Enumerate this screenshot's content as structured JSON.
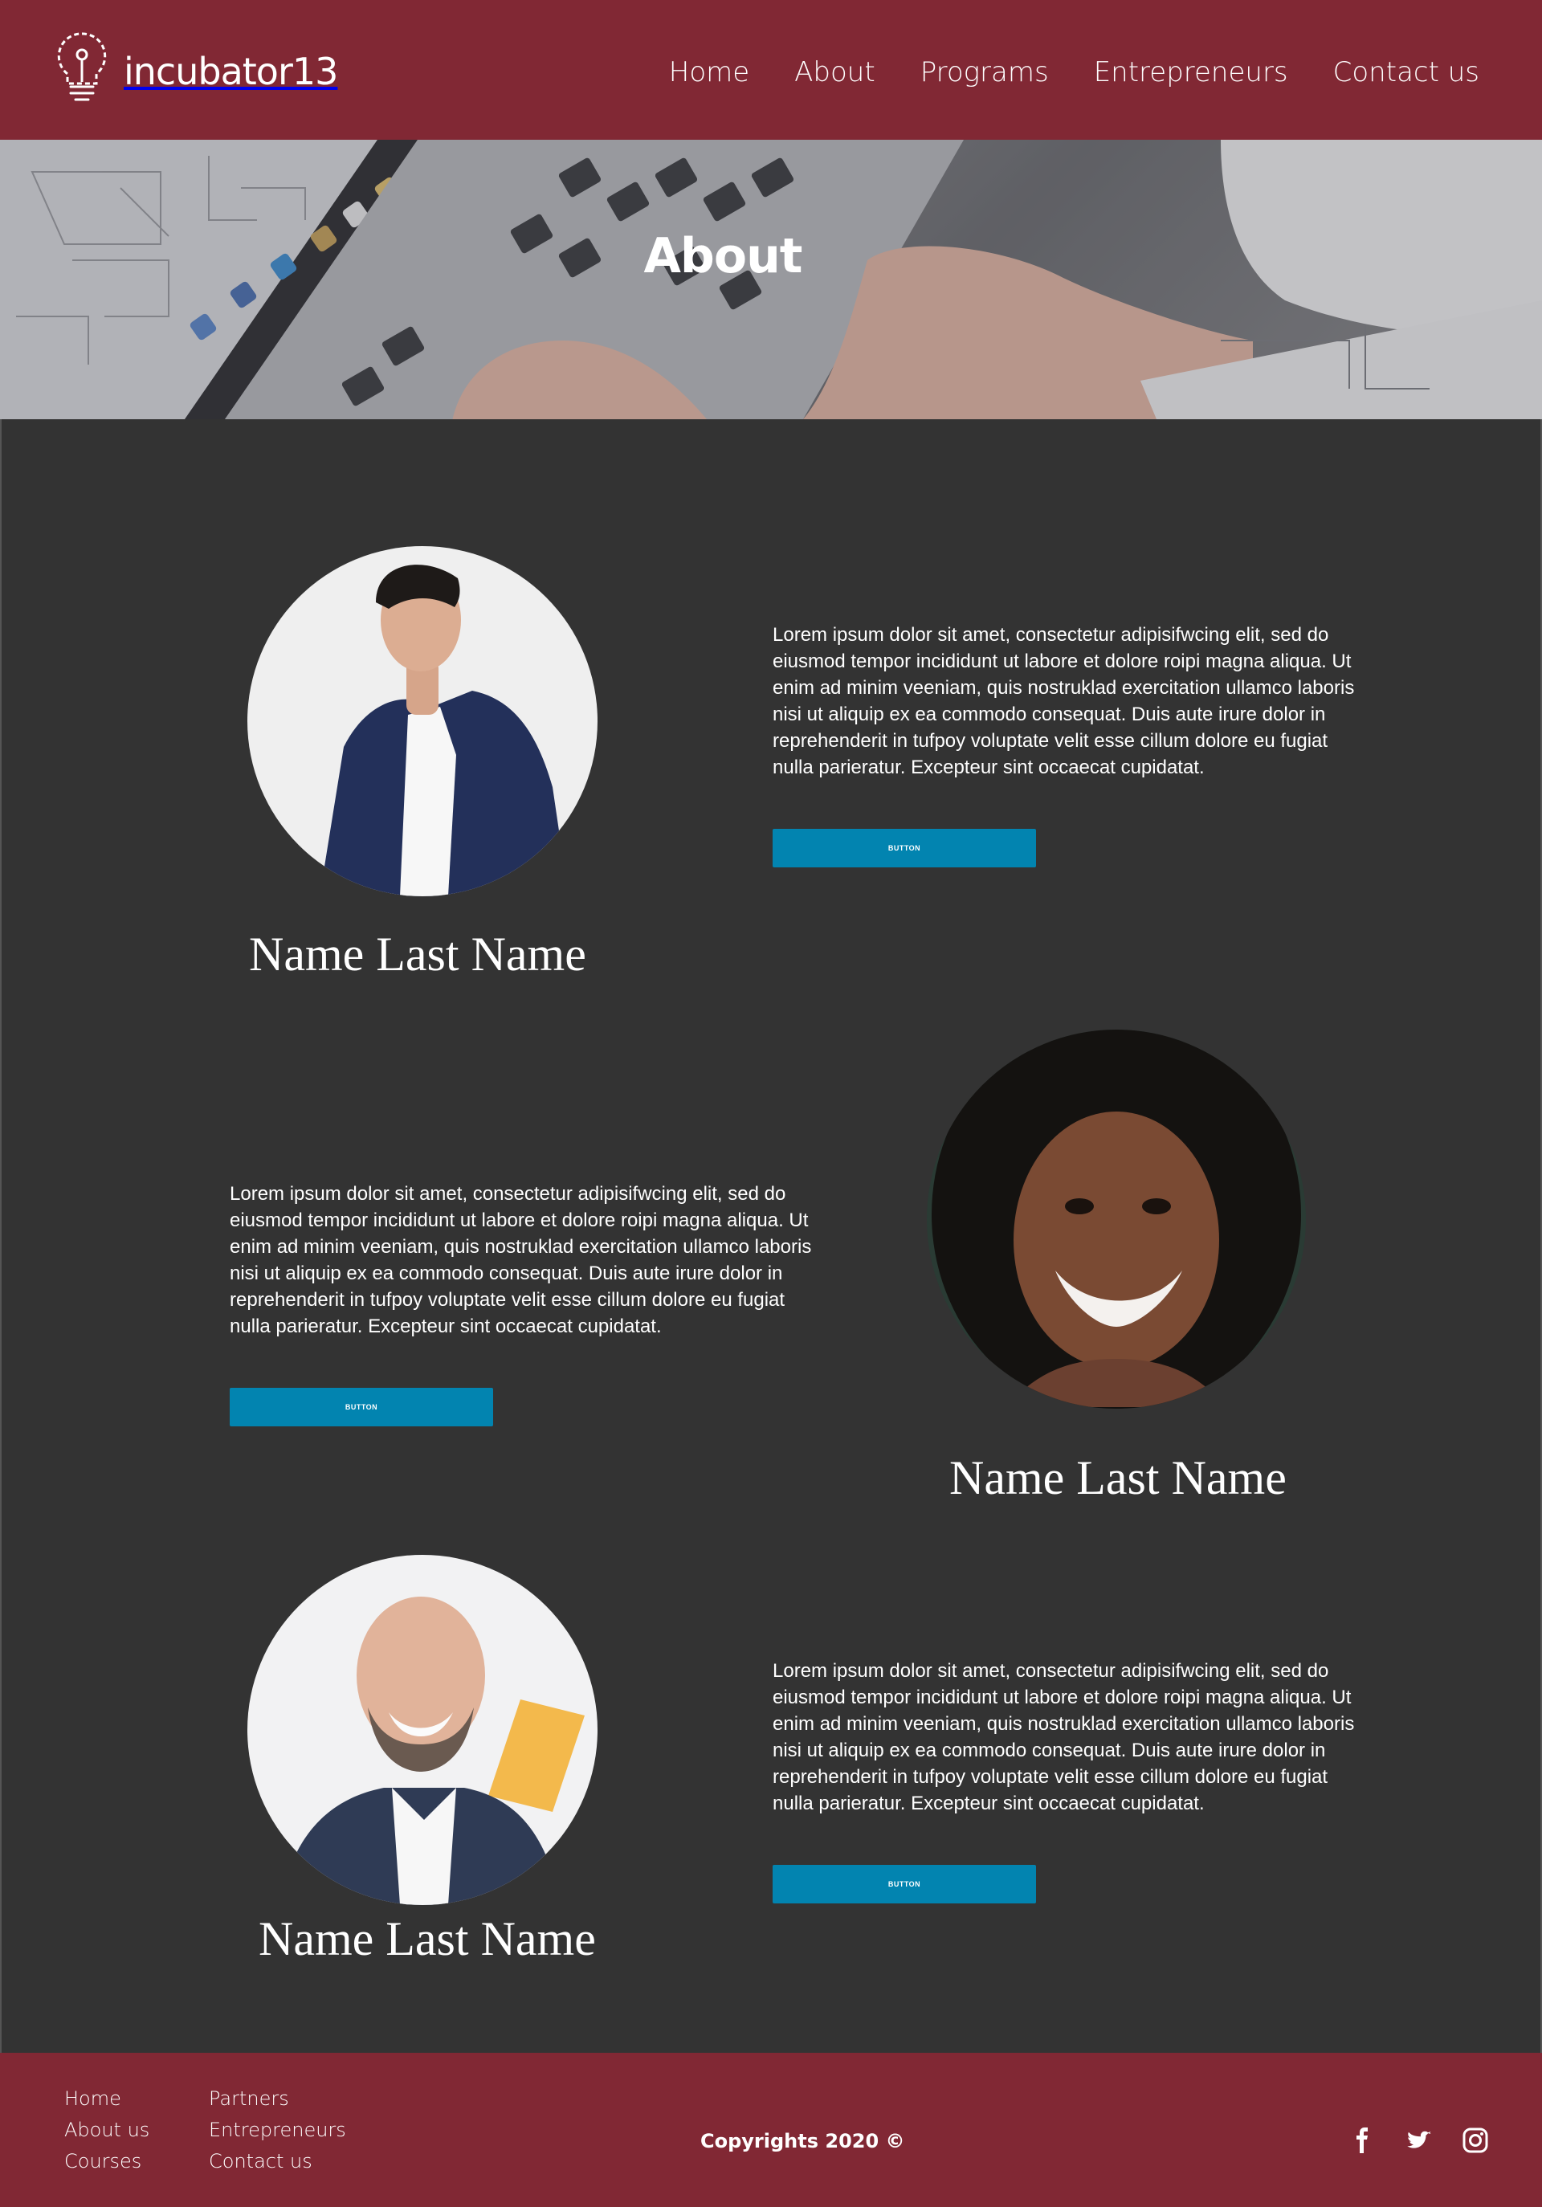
{
  "brand": {
    "name": "incubator13"
  },
  "nav": {
    "items": [
      {
        "label": "Home"
      },
      {
        "label": "About"
      },
      {
        "label": "Programs"
      },
      {
        "label": "Entrepreneurs"
      },
      {
        "label": "Contact us"
      }
    ]
  },
  "hero": {
    "title": "About"
  },
  "members": [
    {
      "name": "Name Last Name",
      "bio": "Lorem ipsum dolor sit amet, consectetur adipisifwcing elit, sed do eiusmod tempor incididunt ut labore et dolore roipi magna aliqua. Ut enim ad minim veeniam, quis nostruklad exercitation ullamco laboris nisi ut aliquip ex ea commodo consequat. Duis aute irure dolor in reprehenderit in tufpoy voluptate velit esse cillum dolore eu fugiat nulla parieratur. Excepteur sint occaecat cupidatat.",
      "button_label": "BUTTON"
    },
    {
      "name": "Name Last Name",
      "bio": "Lorem ipsum dolor sit amet, consectetur adipisifwcing elit, sed do eiusmod tempor incididunt ut labore et dolore roipi magna aliqua. Ut enim ad minim veeniam, quis nostruklad exercitation ullamco laboris nisi ut aliquip ex ea commodo consequat. Duis aute irure dolor in reprehenderit in tufpoy voluptate velit esse cillum dolore eu fugiat nulla parieratur. Excepteur sint occaecat cupidatat.",
      "button_label": "BUTTON"
    },
    {
      "name": "Name Last Name",
      "bio": "Lorem ipsum dolor sit amet, consectetur adipisifwcing elit, sed do eiusmod tempor incididunt ut labore et dolore roipi magna aliqua. Ut enim ad minim veeniam, quis nostruklad exercitation ullamco laboris nisi ut aliquip ex ea commodo consequat. Duis aute irure dolor in reprehenderit in tufpoy voluptate velit esse cillum dolore eu fugiat nulla parieratur. Excepteur sint occaecat cupidatat.",
      "button_label": "BUTTON"
    }
  ],
  "footer": {
    "col1": [
      {
        "label": "Home"
      },
      {
        "label": "About us"
      },
      {
        "label": "Courses"
      }
    ],
    "col2": [
      {
        "label": "Partners"
      },
      {
        "label": "Entrepreneurs"
      },
      {
        "label": "Contact us"
      }
    ],
    "copyright": "Copyrights 2020 ©",
    "social": [
      {
        "icon": "facebook-icon"
      },
      {
        "icon": "twitter-icon"
      },
      {
        "icon": "instagram-icon"
      }
    ]
  },
  "colors": {
    "brand": "#812834",
    "background": "#333333",
    "button": "#0284b0"
  }
}
